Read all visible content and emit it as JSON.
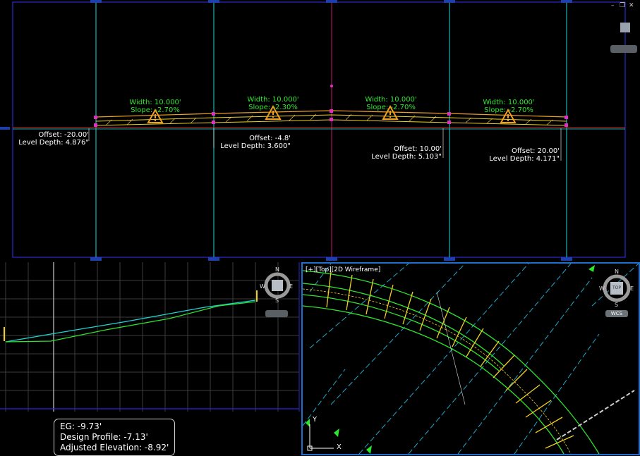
{
  "top_viewport": {
    "window_controls": {
      "minimize": "–",
      "restore": "❐",
      "close": "✕"
    },
    "segments": [
      {
        "width": "Width: 10.000'",
        "slope": "Slope: -2.70%"
      },
      {
        "width": "Width: 10.000'",
        "slope": "Slope: -2.30%"
      },
      {
        "width": "Width: 10.000'",
        "slope": "Slope: -2.70%"
      },
      {
        "width": "Width: 10.000'",
        "slope": "Slope: -2.70%"
      }
    ],
    "offsets": [
      {
        "offset": "Offset: -20.00'",
        "depth": "Level Depth: 4.876\""
      },
      {
        "offset": "Offset: -4.8'",
        "depth": "Level Depth: 3.600\""
      },
      {
        "offset": "Offset: 10.00'",
        "depth": "Level Depth: 5.103\""
      },
      {
        "offset": "Offset: 20.00'",
        "depth": "Level Depth: 4.171\""
      }
    ]
  },
  "profile_viewport": {
    "compass": {
      "n": "N",
      "s": "S",
      "w": "W",
      "e": "E"
    },
    "tooltip": {
      "eg": "EG: -9.73'",
      "design": "Design Profile: -7.13'",
      "adjusted": "Adjusted Elevation: -8.92'"
    }
  },
  "plan_viewport": {
    "viewport_label": "[+][Top][2D Wireframe]",
    "compass": {
      "n": "N",
      "s": "S",
      "w": "W",
      "e": "E",
      "center": "TOP"
    },
    "wcs_button": "WCS",
    "ucs": {
      "y": "Y",
      "x": "X"
    }
  },
  "colors": {
    "cyan": "#1fd6d6",
    "green": "#2ee52e",
    "yellow": "#f0d020",
    "orange": "#f0a020",
    "viewport_border": "#1e6fd0"
  }
}
